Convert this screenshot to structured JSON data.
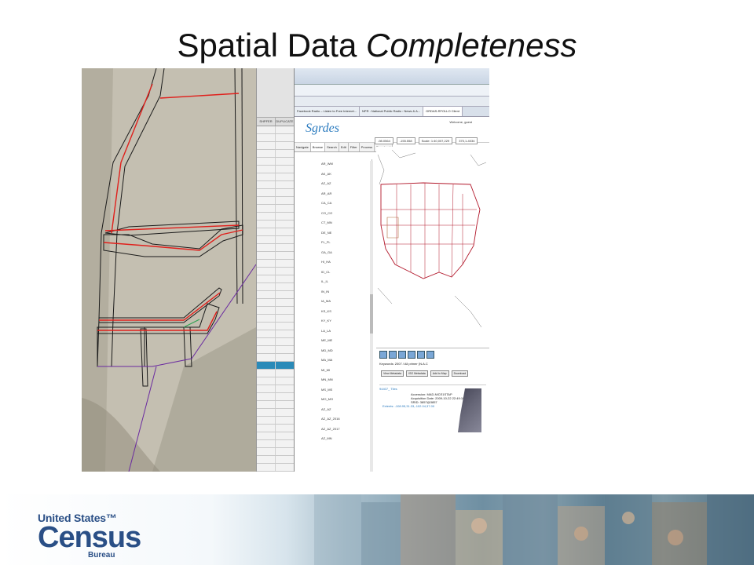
{
  "slide": {
    "title_plain": "Spatial Data ",
    "title_italic": "Completeness"
  },
  "strip": {
    "col1": "SHPFER",
    "col2": "DUPLICATE"
  },
  "browser": {
    "tabs": [
      "Facebook Radio – Listen to Free Internet...",
      "NPR : National Public Radio : News & A...",
      "GRDAS-RFOLLO Client"
    ],
    "app_logo": "Sgrdes",
    "welcome": "Welcome, guest",
    "nav_tabs": [
      "Navigate",
      "Browse",
      "Search",
      "Edit",
      "Filter",
      "Process",
      "Download"
    ],
    "coords": [
      "-98.0564",
      "-155.558",
      "Scale: 1:40,007,229",
      "375,1-4034"
    ],
    "tree_items": [
      "AR_WM",
      "AK_AK",
      "AZ_AZ",
      "AR_AR",
      "CA_CA",
      "CO_CO",
      "CT_MN",
      "DE_NE",
      "FL_FL",
      "GA_GA",
      "HI_HA",
      "ID_CL",
      "IL_IL",
      "IN_IN",
      "IA_MA",
      "KS_KS",
      "KY_KY",
      "LA_LA",
      "ME_ME",
      "MD_MD",
      "MA_MA",
      "MI_MI",
      "MN_MN",
      "MS_MS",
      "MO_MO",
      "AZ_AZ",
      "AZ_AZ_2016",
      "AZ_AZ_2017",
      "AZ_MN"
    ],
    "keywords_label": "Keywords: 2007 / All primer (N.A.C",
    "buttons": [
      "View Metadata",
      "ISO Metadata",
      "Add to Map",
      "Download"
    ],
    "record_title": "94407_ Tiles",
    "record_fields": [
      "Accession: MAD-NICE1STAP",
      "Acquisition Date: 2009-10-22 22:49:10",
      "SRID: 3857@3857",
      "Extents: -108.95,31.33,-102.04,37.00"
    ]
  },
  "footer": {
    "brand_top": "United States™",
    "brand_main": "Census",
    "brand_sub": "Bureau"
  },
  "colors": {
    "title": "#111111",
    "brand_blue": "#2a4f86",
    "brand_red": "#c7202e",
    "map_red": "#b2182b",
    "map_blue": "#2b7bbf"
  }
}
